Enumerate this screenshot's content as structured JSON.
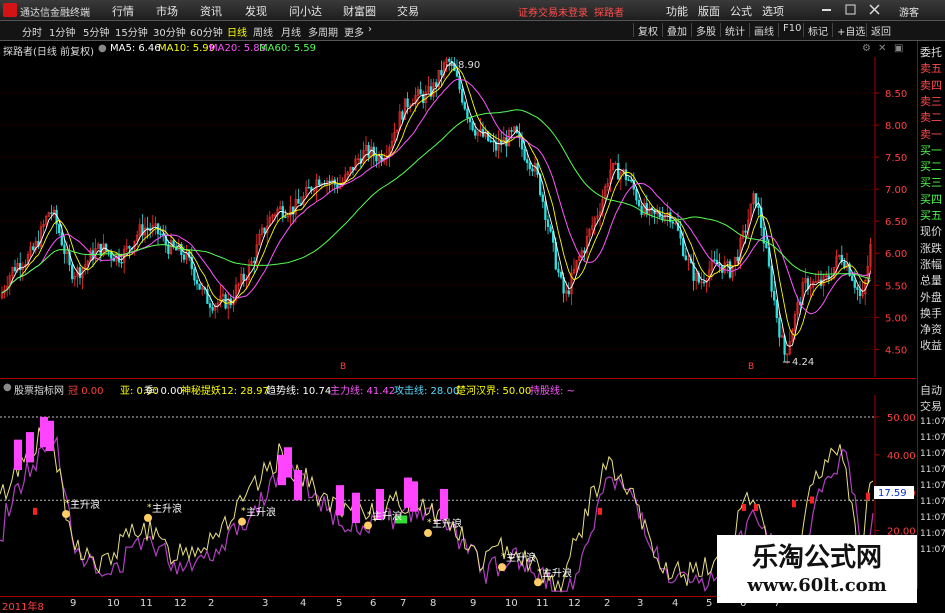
{
  "app": {
    "title": "通达信金融终端"
  },
  "menu": {
    "items": [
      "行情",
      "市场",
      "资讯",
      "发现",
      "问小达",
      "财富圈",
      "交易"
    ],
    "trade_status": "证券交易未登录",
    "user_link": "探路者",
    "right": [
      "功能",
      "版面",
      "公式",
      "选项"
    ],
    "guest": "游客"
  },
  "toolbar": {
    "periods": [
      "分时",
      "1分钟",
      "5分钟",
      "15分钟",
      "30分钟",
      "60分钟",
      "日线",
      "周线",
      "月线",
      "多周期",
      "更多"
    ],
    "active": "日线",
    "right": [
      "复权",
      "叠加",
      "多股",
      "统计",
      "画线",
      "F10",
      "标记",
      "+自选",
      "返回"
    ]
  },
  "main_header": {
    "stock": "探路者(日线 前复权)",
    "ma5": "MA5: 6.46",
    "ma10": "MA10: 5.99",
    "ma20": "MA20: 5.83",
    "ma60": "MA60: 5.59",
    "colors": {
      "ma5": "#ffffff",
      "ma10": "#ffff00",
      "ma20": "#ff55ff",
      "ma60": "#55ff55"
    }
  },
  "price_axis": [
    "8.50",
    "8.00",
    "7.50",
    "7.00",
    "6.50",
    "6.00",
    "5.50",
    "5.00",
    "4.50"
  ],
  "price_annotations": {
    "high": "8.90",
    "low": "4.24"
  },
  "right_panel": {
    "labels": [
      "委托",
      "卖五",
      "卖四",
      "卖三",
      "卖二",
      "卖一",
      "买一",
      "买二",
      "买三",
      "买四",
      "买五",
      "现价",
      "涨跌",
      "涨幅",
      "总量",
      "外盘",
      "换手",
      "净资",
      "收益"
    ],
    "lower": [
      "自动",
      "交易",
      "11:07",
      "11:07",
      "11:07",
      "11:07",
      "11:07",
      "11:07",
      "11:07",
      "11:07",
      "11:07"
    ]
  },
  "indicator_header": {
    "name": "股票指标网",
    "v1": "0.00",
    "ya": "亚: 0.00",
    "ji": "季: 0.00",
    "shenmi": "神秘提妖12: 28.97",
    "qushi": "趋势线: 10.74",
    "zhuli": "主力线: 41.42",
    "gongji": "攻击线: 28.00",
    "chuhe": "楚河汉界: 50.00",
    "chigu": "持股线: ~"
  },
  "indicator_axis": [
    "50.00",
    "40.00",
    "30.00",
    "20.00",
    "10.00"
  ],
  "indicator_current": "17.59",
  "signal_label": "主升浪",
  "signal_b": "B",
  "watermark": {
    "line1": "乐淘公式网",
    "line2": "www.60lt.com"
  },
  "date_axis": [
    "2011年8",
    "9",
    "10",
    "11",
    "12",
    "2",
    "3",
    "4",
    "5",
    "6",
    "7",
    "8",
    "9",
    "10",
    "11",
    "12",
    "2",
    "3",
    "4",
    "5",
    "6",
    "7"
  ]
}
